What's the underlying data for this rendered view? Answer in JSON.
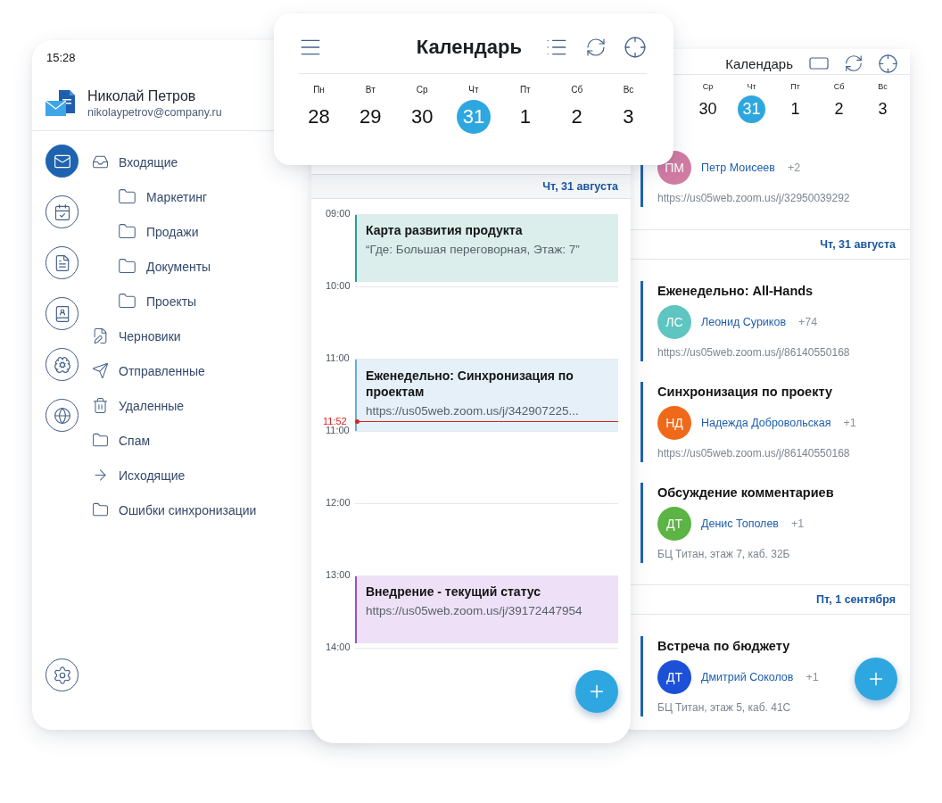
{
  "mail_screen": {
    "status_time": "15:28",
    "account": {
      "name": "Николай Петров",
      "email": "nikolaypetrov@company.ru"
    },
    "rail": [
      {
        "selected": true
      },
      {
        "selected": false
      },
      {
        "selected": false
      },
      {
        "selected": false
      },
      {
        "selected": false
      },
      {
        "selected": false
      }
    ],
    "folders": [
      {
        "label": "Входящие",
        "children": [
          {
            "label": "Маркетинг"
          },
          {
            "label": "Продажи"
          },
          {
            "label": "Документы"
          },
          {
            "label": "Проекты"
          }
        ]
      },
      {
        "label": "Черновики"
      },
      {
        "label": "Отправленные"
      },
      {
        "label": "Удаленные"
      },
      {
        "label": "Спам"
      },
      {
        "label": "Исходящие"
      },
      {
        "label": "Ошибки синхронизации"
      }
    ]
  },
  "agenda_screen": {
    "title": "Календарь",
    "days": [
      {
        "weekday": "Ср",
        "date": "30",
        "selected": false
      },
      {
        "weekday": "Чт",
        "date": "31",
        "selected": true
      },
      {
        "weekday": "Пт",
        "date": "1",
        "selected": false
      },
      {
        "weekday": "Сб",
        "date": "2",
        "selected": false
      },
      {
        "weekday": "Вс",
        "date": "3",
        "selected": false
      }
    ],
    "sections": [
      {
        "events": [
          {
            "organizer": "Петр Моисеев",
            "initials": "ПМ",
            "color": "#d27ba3",
            "extra": "+2",
            "location": "https://us05web.zoom.us/j/32950039292"
          }
        ]
      },
      {
        "date_header": "Чт, 31 августа",
        "events": [
          {
            "title": "Еженедельно: All-Hands",
            "organizer": "Леонид Суриков",
            "initials": "ЛС",
            "color": "#5ec5c1",
            "extra": "+74",
            "location": "https://us05web.zoom.us/j/86140550168"
          },
          {
            "title": "Синхронизация по проекту",
            "organizer": "Надежда Добровольская",
            "initials": "НД",
            "color": "#f0691b",
            "extra": "+1",
            "location": "https://us05web.zoom.us/j/86140550168"
          },
          {
            "title": "Обсуждение комментариев",
            "organizer": "Денис Тополев",
            "initials": "ДТ",
            "color": "#5bb443",
            "extra": "+1",
            "location": "БЦ Титан, этаж 7, каб. 32Б"
          }
        ]
      },
      {
        "date_header": "Пт, 1 сентября",
        "events": [
          {
            "title": "Встреча по бюджету",
            "organizer": "Дмитрий Соколов",
            "initials": "ДТ",
            "color": "#1c50d8",
            "extra": "+1",
            "location": "БЦ Титан, этаж 5, каб. 41С"
          }
        ]
      }
    ]
  },
  "day_screen": {
    "date_header": "Чт, 31 августа",
    "slots": [
      {
        "time": "09:00",
        "events": [
          {
            "title": "Карта развития продукта",
            "detail": "“Где: Большая переговорная, Этаж: 7”",
            "color": "#2a9d8f"
          }
        ]
      },
      {
        "time": "10:00"
      },
      {
        "time": "11:00",
        "events": [
          {
            "title": "Еженедельно: Синхронизация по проектам",
            "detail": "https://us05web.zoom.us/j/342907225...",
            "color": "#6aa9dc"
          }
        ],
        "now": "11:52"
      },
      {
        "time": "11:00"
      },
      {
        "time": "12:00"
      },
      {
        "time": "13:00",
        "events": [
          {
            "title": "Внедрение - текущий статус",
            "detail": "https://us05web.zoom.us/j/39172447954",
            "color": "#9b4fd0"
          }
        ]
      },
      {
        "time": "14:00"
      }
    ]
  },
  "calendar_popup": {
    "title": "Календарь",
    "days": [
      {
        "weekday": "Пн",
        "date": "28",
        "selected": false
      },
      {
        "weekday": "Вт",
        "date": "29",
        "selected": false
      },
      {
        "weekday": "Ср",
        "date": "30",
        "selected": false
      },
      {
        "weekday": "Чт",
        "date": "31",
        "selected": true
      },
      {
        "weekday": "Пт",
        "date": "1",
        "selected": false
      },
      {
        "weekday": "Сб",
        "date": "2",
        "selected": false
      },
      {
        "weekday": "Вс",
        "date": "3",
        "selected": false
      }
    ]
  }
}
